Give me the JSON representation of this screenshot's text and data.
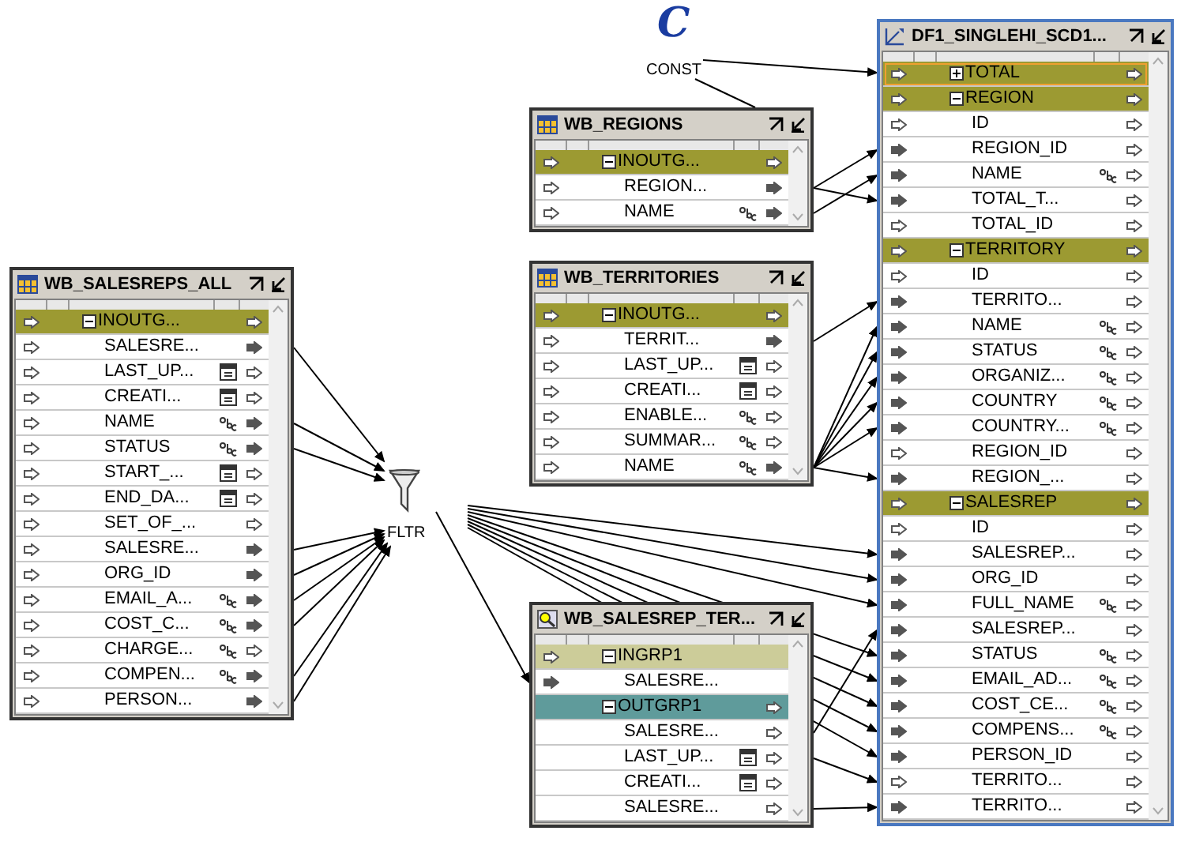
{
  "constant": {
    "symbol": "C",
    "label": "CONST"
  },
  "filter": {
    "label": "FLTR"
  },
  "operators": [
    {
      "title": "WB_SALESREPS_ALL",
      "kind": "table",
      "rows": [
        {
          "label": "INOUTG...",
          "kind": "group",
          "expanded": true,
          "color": "#9c9a32",
          "in_mapped": false,
          "out_mapped": false,
          "selected": false
        },
        {
          "label": "SALESRE...",
          "kind": "attribute",
          "date_type": false,
          "text_type": false,
          "in_mapped": false,
          "out_mapped": true,
          "selected": false
        },
        {
          "label": "LAST_UP...",
          "kind": "attribute",
          "date_type": true,
          "text_type": false,
          "in_mapped": false,
          "out_mapped": false,
          "selected": false
        },
        {
          "label": "CREATI...",
          "kind": "attribute",
          "date_type": true,
          "text_type": false,
          "in_mapped": false,
          "out_mapped": false,
          "selected": false
        },
        {
          "label": "NAME",
          "kind": "attribute",
          "date_type": false,
          "text_type": true,
          "in_mapped": false,
          "out_mapped": true,
          "selected": false
        },
        {
          "label": "STATUS",
          "kind": "attribute",
          "date_type": false,
          "text_type": true,
          "in_mapped": false,
          "out_mapped": true,
          "selected": false
        },
        {
          "label": "START_...",
          "kind": "attribute",
          "date_type": true,
          "text_type": false,
          "in_mapped": false,
          "out_mapped": false,
          "selected": false
        },
        {
          "label": "END_DA...",
          "kind": "attribute",
          "date_type": true,
          "text_type": false,
          "in_mapped": false,
          "out_mapped": false,
          "selected": false
        },
        {
          "label": "SET_OF_...",
          "kind": "attribute",
          "date_type": false,
          "text_type": false,
          "in_mapped": false,
          "out_mapped": false,
          "selected": false
        },
        {
          "label": "SALESRE...",
          "kind": "attribute",
          "date_type": false,
          "text_type": false,
          "in_mapped": false,
          "out_mapped": true,
          "selected": false
        },
        {
          "label": "ORG_ID",
          "kind": "attribute",
          "date_type": false,
          "text_type": false,
          "in_mapped": false,
          "out_mapped": true,
          "selected": false
        },
        {
          "label": "EMAIL_A...",
          "kind": "attribute",
          "date_type": false,
          "text_type": true,
          "in_mapped": false,
          "out_mapped": true,
          "selected": false
        },
        {
          "label": "COST_C...",
          "kind": "attribute",
          "date_type": false,
          "text_type": true,
          "in_mapped": false,
          "out_mapped": true,
          "selected": false
        },
        {
          "label": "CHARGE...",
          "kind": "attribute",
          "date_type": false,
          "text_type": true,
          "in_mapped": false,
          "out_mapped": false,
          "selected": false
        },
        {
          "label": "COMPEN...",
          "kind": "attribute",
          "date_type": false,
          "text_type": true,
          "in_mapped": false,
          "out_mapped": true,
          "selected": false
        },
        {
          "label": "PERSON...",
          "kind": "attribute",
          "date_type": false,
          "text_type": false,
          "in_mapped": false,
          "out_mapped": true,
          "selected": false
        }
      ]
    },
    {
      "title": "WB_REGIONS",
      "kind": "table",
      "rows": [
        {
          "label": "INOUTG...",
          "kind": "group",
          "expanded": true,
          "color": "#9c9a32",
          "in_mapped": false,
          "out_mapped": false,
          "selected": false
        },
        {
          "label": "REGION...",
          "kind": "attribute",
          "date_type": false,
          "text_type": false,
          "in_mapped": false,
          "out_mapped": true,
          "selected": false
        },
        {
          "label": "NAME",
          "kind": "attribute",
          "date_type": false,
          "text_type": true,
          "in_mapped": false,
          "out_mapped": true,
          "selected": false
        }
      ]
    },
    {
      "title": "WB_TERRITORIES",
      "kind": "table",
      "rows": [
        {
          "label": "INOUTG...",
          "kind": "group",
          "expanded": true,
          "color": "#9c9a32",
          "in_mapped": false,
          "out_mapped": false,
          "selected": false
        },
        {
          "label": "TERRIT...",
          "kind": "attribute",
          "date_type": false,
          "text_type": false,
          "in_mapped": false,
          "out_mapped": true,
          "selected": false
        },
        {
          "label": "LAST_UP...",
          "kind": "attribute",
          "date_type": true,
          "text_type": false,
          "in_mapped": false,
          "out_mapped": false,
          "selected": false
        },
        {
          "label": "CREATI...",
          "kind": "attribute",
          "date_type": true,
          "text_type": false,
          "in_mapped": false,
          "out_mapped": false,
          "selected": false
        },
        {
          "label": "ENABLE...",
          "kind": "attribute",
          "date_type": false,
          "text_type": true,
          "in_mapped": false,
          "out_mapped": false,
          "selected": false
        },
        {
          "label": "SUMMAR...",
          "kind": "attribute",
          "date_type": false,
          "text_type": true,
          "in_mapped": false,
          "out_mapped": false,
          "selected": false
        },
        {
          "label": "NAME",
          "kind": "attribute",
          "date_type": false,
          "text_type": true,
          "in_mapped": false,
          "out_mapped": true,
          "selected": false
        }
      ]
    },
    {
      "title": "WB_SALESREP_TER...",
      "kind": "splitter",
      "rows": [
        {
          "label": "INGRP1",
          "kind": "group",
          "expanded": true,
          "color": "#cccc99",
          "in_mapped": false,
          "selected": false
        },
        {
          "label": "SALESRE...",
          "kind": "attribute",
          "date_type": false,
          "text_type": false,
          "in_mapped": true,
          "selected": false
        },
        {
          "label": "OUTGRP1",
          "kind": "group",
          "expanded": true,
          "color": "#5f9b9b",
          "out_mapped": false,
          "selected": false
        },
        {
          "label": "SALESRE...",
          "kind": "attribute",
          "date_type": false,
          "text_type": false,
          "out_mapped": false,
          "selected": false
        },
        {
          "label": "LAST_UP...",
          "kind": "attribute",
          "date_type": true,
          "text_type": false,
          "out_mapped": false,
          "selected": false
        },
        {
          "label": "CREATI...",
          "kind": "attribute",
          "date_type": true,
          "text_type": false,
          "out_mapped": false,
          "selected": false
        },
        {
          "label": "SALESRE...",
          "kind": "attribute",
          "date_type": false,
          "text_type": false,
          "out_mapped": false,
          "selected": false
        }
      ]
    },
    {
      "title": "DF1_SINGLEHI_SCD1...",
      "kind": "dimension",
      "rows": [
        {
          "label": "TOTAL",
          "kind": "group",
          "expanded": false,
          "color": "#9c9a32",
          "in_mapped": false,
          "out_mapped": false,
          "selected": true
        },
        {
          "label": "REGION",
          "kind": "group",
          "expanded": true,
          "color": "#9c9a32",
          "in_mapped": false,
          "out_mapped": false,
          "selected": false
        },
        {
          "label": "ID",
          "kind": "attribute",
          "date_type": false,
          "text_type": false,
          "in_mapped": false,
          "out_mapped": false,
          "selected": false
        },
        {
          "label": "REGION_ID",
          "kind": "attribute",
          "date_type": false,
          "text_type": false,
          "in_mapped": true,
          "out_mapped": false,
          "selected": false
        },
        {
          "label": "NAME",
          "kind": "attribute",
          "date_type": false,
          "text_type": true,
          "in_mapped": true,
          "out_mapped": false,
          "selected": false
        },
        {
          "label": "TOTAL_T...",
          "kind": "attribute",
          "date_type": false,
          "text_type": false,
          "in_mapped": true,
          "out_mapped": false,
          "selected": false
        },
        {
          "label": "TOTAL_ID",
          "kind": "attribute",
          "date_type": false,
          "text_type": false,
          "in_mapped": false,
          "out_mapped": false,
          "selected": false
        },
        {
          "label": "TERRITORY",
          "kind": "group",
          "expanded": true,
          "color": "#9c9a32",
          "in_mapped": false,
          "out_mapped": false,
          "selected": false
        },
        {
          "label": "ID",
          "kind": "attribute",
          "date_type": false,
          "text_type": false,
          "in_mapped": false,
          "out_mapped": false,
          "selected": false
        },
        {
          "label": "TERRITO...",
          "kind": "attribute",
          "date_type": false,
          "text_type": false,
          "in_mapped": true,
          "out_mapped": false,
          "selected": false
        },
        {
          "label": "NAME",
          "kind": "attribute",
          "date_type": false,
          "text_type": true,
          "in_mapped": true,
          "out_mapped": false,
          "selected": false
        },
        {
          "label": "STATUS",
          "kind": "attribute",
          "date_type": false,
          "text_type": true,
          "in_mapped": true,
          "out_mapped": false,
          "selected": false
        },
        {
          "label": "ORGANIZ...",
          "kind": "attribute",
          "date_type": false,
          "text_type": true,
          "in_mapped": true,
          "out_mapped": false,
          "selected": false
        },
        {
          "label": "COUNTRY",
          "kind": "attribute",
          "date_type": false,
          "text_type": true,
          "in_mapped": true,
          "out_mapped": false,
          "selected": false
        },
        {
          "label": "COUNTRY...",
          "kind": "attribute",
          "date_type": false,
          "text_type": true,
          "in_mapped": true,
          "out_mapped": false,
          "selected": false
        },
        {
          "label": "REGION_ID",
          "kind": "attribute",
          "date_type": false,
          "text_type": false,
          "in_mapped": false,
          "out_mapped": false,
          "selected": false
        },
        {
          "label": "REGION_...",
          "kind": "attribute",
          "date_type": false,
          "text_type": false,
          "in_mapped": true,
          "out_mapped": false,
          "selected": false
        },
        {
          "label": "SALESREP",
          "kind": "group",
          "expanded": true,
          "color": "#9c9a32",
          "in_mapped": false,
          "out_mapped": false,
          "selected": false
        },
        {
          "label": "ID",
          "kind": "attribute",
          "date_type": false,
          "text_type": false,
          "in_mapped": false,
          "out_mapped": false,
          "selected": false
        },
        {
          "label": "SALESREP...",
          "kind": "attribute",
          "date_type": false,
          "text_type": false,
          "in_mapped": true,
          "out_mapped": false,
          "selected": false
        },
        {
          "label": "ORG_ID",
          "kind": "attribute",
          "date_type": false,
          "text_type": false,
          "in_mapped": true,
          "out_mapped": false,
          "selected": false
        },
        {
          "label": "FULL_NAME",
          "kind": "attribute",
          "date_type": false,
          "text_type": true,
          "in_mapped": true,
          "out_mapped": false,
          "selected": false
        },
        {
          "label": "SALESREP...",
          "kind": "attribute",
          "date_type": false,
          "text_type": false,
          "in_mapped": true,
          "out_mapped": false,
          "selected": false
        },
        {
          "label": "STATUS",
          "kind": "attribute",
          "date_type": false,
          "text_type": true,
          "in_mapped": true,
          "out_mapped": false,
          "selected": false
        },
        {
          "label": "EMAIL_AD...",
          "kind": "attribute",
          "date_type": false,
          "text_type": true,
          "in_mapped": true,
          "out_mapped": false,
          "selected": false
        },
        {
          "label": "COST_CE...",
          "kind": "attribute",
          "date_type": false,
          "text_type": true,
          "in_mapped": true,
          "out_mapped": false,
          "selected": false
        },
        {
          "label": "COMPENS...",
          "kind": "attribute",
          "date_type": false,
          "text_type": true,
          "in_mapped": true,
          "out_mapped": false,
          "selected": false
        },
        {
          "label": "PERSON_ID",
          "kind": "attribute",
          "date_type": false,
          "text_type": false,
          "in_mapped": true,
          "out_mapped": false,
          "selected": false
        },
        {
          "label": "TERRITO...",
          "kind": "attribute",
          "date_type": false,
          "text_type": false,
          "in_mapped": false,
          "out_mapped": false,
          "selected": false
        },
        {
          "label": "TERRITO...",
          "kind": "attribute",
          "date_type": false,
          "text_type": false,
          "in_mapped": true,
          "out_mapped": false,
          "selected": false
        }
      ]
    }
  ]
}
